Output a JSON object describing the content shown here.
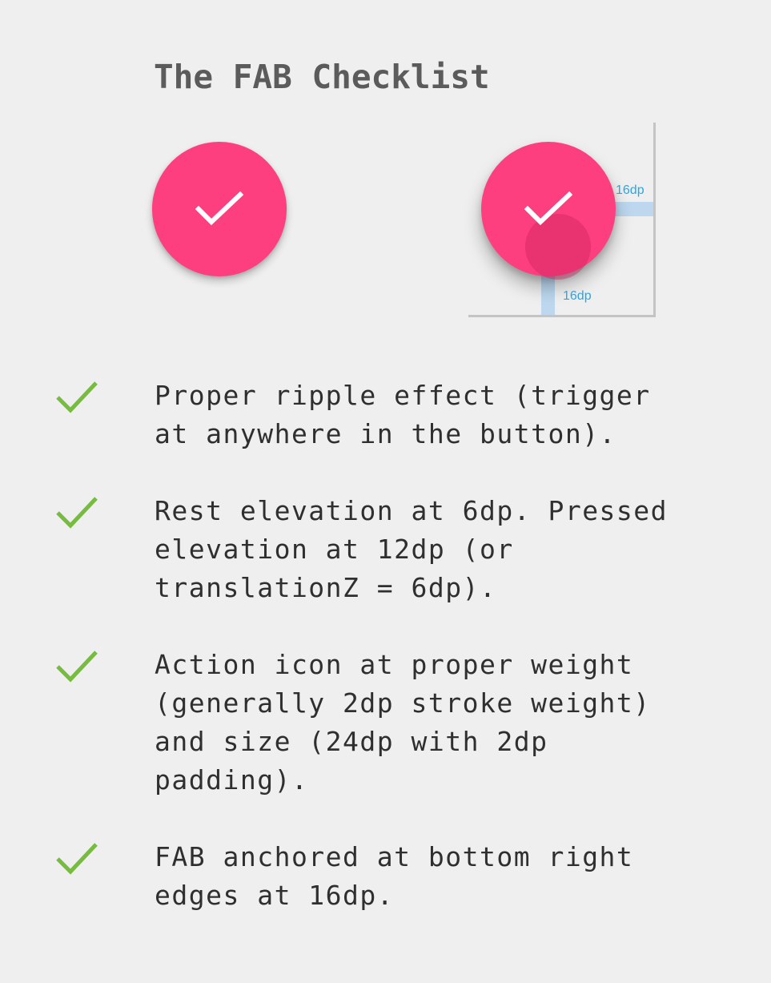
{
  "title": "The FAB Checklist",
  "colors": {
    "fab": "#fe3f7f",
    "check_green": "#76bc3e",
    "dimension_blue": "#2aa5e4",
    "spacing_fill": "#bcd7ee"
  },
  "fab_demo": {
    "right_gap_label": "16dp",
    "bottom_gap_label": "16dp"
  },
  "checklist": [
    {
      "icon": "check-icon",
      "text": "Proper ripple effect (trigger\nat anywhere in the button)."
    },
    {
      "icon": "check-icon",
      "text": "Rest elevation at 6dp. Pressed\nelevation at 12dp (or\ntranslationZ = 6dp)."
    },
    {
      "icon": "check-icon",
      "text": "Action icon at proper weight\n(generally 2dp stroke weight)\nand size (24dp with 2dp\npadding)."
    },
    {
      "icon": "check-icon",
      "text": "FAB anchored at bottom right\nedges at 16dp."
    }
  ]
}
